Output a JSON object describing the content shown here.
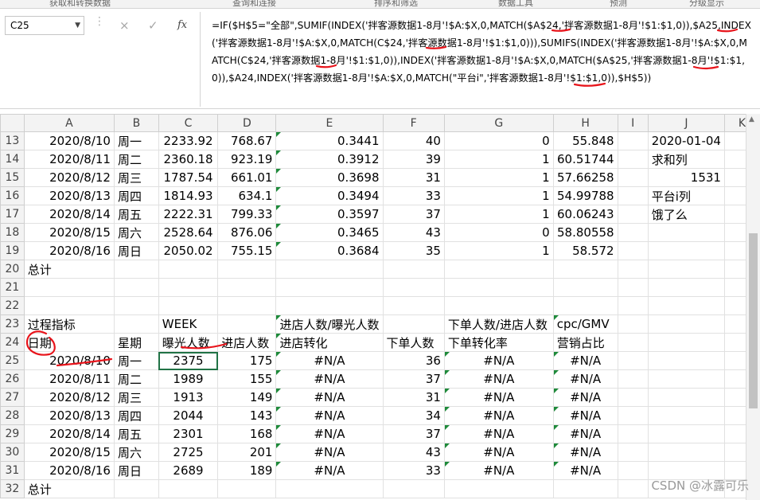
{
  "ribbon": {
    "labels": [
      "获取和转换数据",
      "查询和连接",
      "排序和筛选",
      "数据工具",
      "预测",
      "分级显示"
    ]
  },
  "formula_bar": {
    "name_box": "C25",
    "cancel_icon": "×",
    "enter_icon": "✓",
    "fx_label": "fx",
    "formula": "=IF($H$5=\"全部\",SUMIF(INDEX('拌客源数据1-8月'!$A:$X,0,MATCH($A$24,'拌客源数据1-8月'!$1:$1,0)),$A25,INDEX('拌客源数据1-8月'!$A:$X,0,MATCH(C$24,'拌客源数据1-8月'!$1:$1,0))),SUMIFS(INDEX('拌客源数据1-8月'!$A:$X,0,MATCH(C$24,'拌客源数据1-8月'!$1:$1,0)),INDEX('拌客源数据1-8月'!$A:$X,0,MATCH($A$25,'拌客源数据1-8月'!$1:$1,0)),$A24,INDEX('拌客源数据1-8月'!$A:$X,0,MATCH(\"平台i\",'拌客源数据1-8月'!$1:$1,0)),$H$5))"
  },
  "columns": [
    "A",
    "B",
    "C",
    "D",
    "E",
    "F",
    "G",
    "H",
    "I",
    "J",
    "K"
  ],
  "rows": [
    {
      "n": "13",
      "cells": [
        "2020/8/10",
        "周一",
        "2233.92",
        "768.67",
        "0.3441",
        "40",
        "0",
        "55.848",
        "",
        "2020-01-04",
        ""
      ]
    },
    {
      "n": "14",
      "cells": [
        "2020/8/11",
        "周二",
        "2360.18",
        "923.19",
        "0.3912",
        "39",
        "1",
        "60.51744",
        "",
        "求和列",
        ""
      ]
    },
    {
      "n": "15",
      "cells": [
        "2020/8/12",
        "周三",
        "1787.54",
        "661.01",
        "0.3698",
        "31",
        "1",
        "57.66258",
        "",
        "1531",
        ""
      ]
    },
    {
      "n": "16",
      "cells": [
        "2020/8/13",
        "周四",
        "1814.93",
        "634.1",
        "0.3494",
        "33",
        "1",
        "54.99788",
        "",
        "平台i列",
        ""
      ]
    },
    {
      "n": "17",
      "cells": [
        "2020/8/14",
        "周五",
        "2222.31",
        "799.33",
        "0.3597",
        "37",
        "1",
        "60.06243",
        "",
        "饿了么",
        ""
      ]
    },
    {
      "n": "18",
      "cells": [
        "2020/8/15",
        "周六",
        "2528.64",
        "876.06",
        "0.3465",
        "43",
        "0",
        "58.80558",
        "",
        "",
        ""
      ]
    },
    {
      "n": "19",
      "cells": [
        "2020/8/16",
        "周日",
        "2050.02",
        "755.15",
        "0.3684",
        "35",
        "1",
        "58.572",
        "",
        "",
        ""
      ]
    },
    {
      "n": "20",
      "cells": [
        "总计",
        "",
        "",
        "",
        "",
        "",
        "",
        "",
        "",
        "",
        ""
      ]
    },
    {
      "n": "21",
      "cells": [
        "",
        "",
        "",
        "",
        "",
        "",
        "",
        "",
        "",
        "",
        ""
      ]
    },
    {
      "n": "22",
      "cells": [
        "",
        "",
        "",
        "",
        "",
        "",
        "",
        "",
        "",
        "",
        ""
      ]
    },
    {
      "n": "23",
      "cells": [
        "过程指标",
        "",
        "WEEK",
        "",
        "进店人数/曝光人数",
        "",
        "下单人数/进店人数",
        "cpc/GMV",
        "",
        "",
        ""
      ]
    },
    {
      "n": "24",
      "cells": [
        "日期",
        "星期",
        "曝光人数",
        "进店人数",
        "进店转化",
        "下单人数",
        "下单转化率",
        "营销占比",
        "",
        "",
        ""
      ]
    },
    {
      "n": "25",
      "cells": [
        "2020/8/10",
        "周一",
        "2375",
        "175",
        "#N/A",
        "36",
        "#N/A",
        "#N/A",
        "",
        "",
        ""
      ]
    },
    {
      "n": "26",
      "cells": [
        "2020/8/11",
        "周二",
        "1989",
        "155",
        "#N/A",
        "37",
        "#N/A",
        "#N/A",
        "",
        "",
        ""
      ]
    },
    {
      "n": "27",
      "cells": [
        "2020/8/12",
        "周三",
        "1913",
        "149",
        "#N/A",
        "31",
        "#N/A",
        "#N/A",
        "",
        "",
        ""
      ]
    },
    {
      "n": "28",
      "cells": [
        "2020/8/13",
        "周四",
        "2044",
        "143",
        "#N/A",
        "34",
        "#N/A",
        "#N/A",
        "",
        "",
        ""
      ]
    },
    {
      "n": "29",
      "cells": [
        "2020/8/14",
        "周五",
        "2301",
        "168",
        "#N/A",
        "37",
        "#N/A",
        "#N/A",
        "",
        "",
        ""
      ]
    },
    {
      "n": "30",
      "cells": [
        "2020/8/15",
        "周六",
        "2725",
        "201",
        "#N/A",
        "43",
        "#N/A",
        "#N/A",
        "",
        "",
        ""
      ]
    },
    {
      "n": "31",
      "cells": [
        "2020/8/16",
        "周日",
        "2689",
        "189",
        "#N/A",
        "33",
        "#N/A",
        "#N/A",
        "",
        "",
        ""
      ]
    },
    {
      "n": "32",
      "cells": [
        "总计",
        "",
        "",
        "",
        "",
        "",
        "",
        "",
        "",
        "",
        ""
      ]
    }
  ],
  "watermark": "CSDN @冰露可乐",
  "colors": {
    "annotation_red": "#e8141b",
    "excel_green": "#217346",
    "error_flag_green": "#1e8a3a"
  }
}
